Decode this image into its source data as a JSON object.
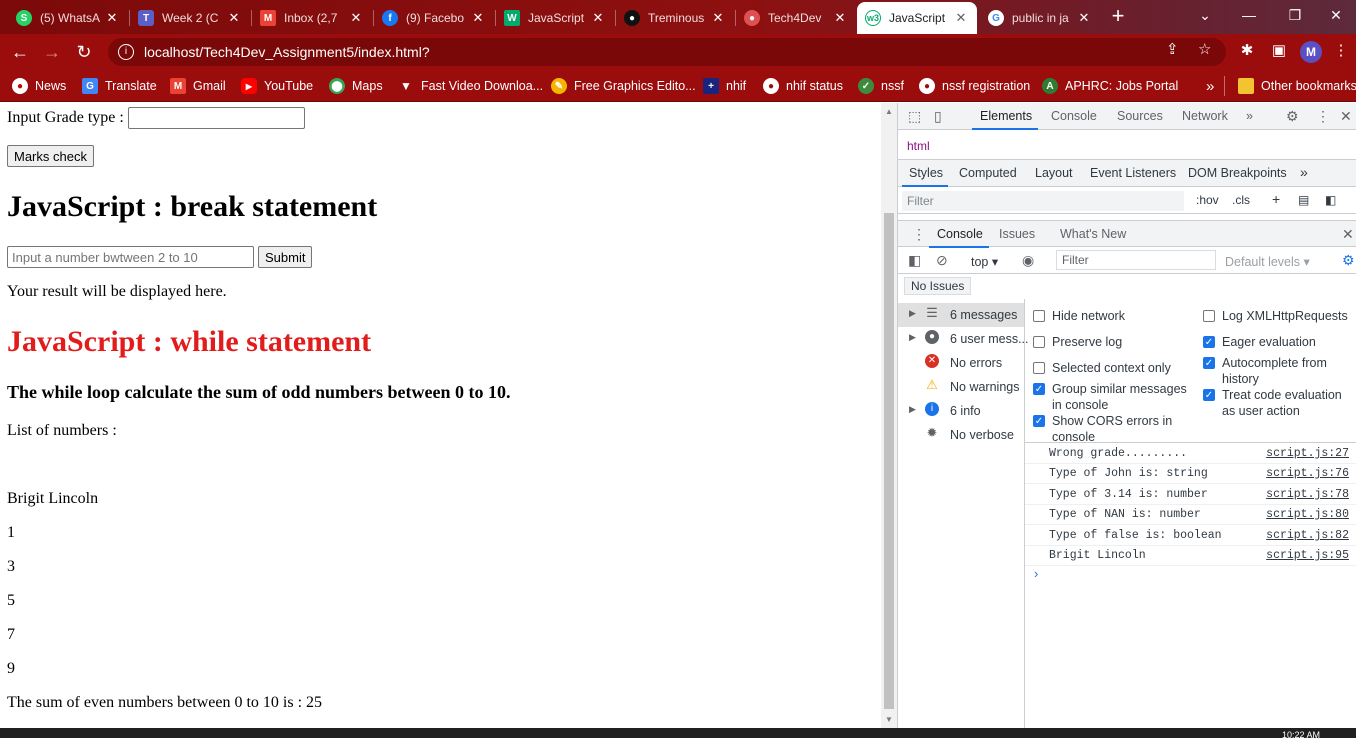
{
  "tabs": [
    {
      "title": "(5) WhatsA",
      "fav": "S",
      "color": "#25d366"
    },
    {
      "title": "Week 2 (C",
      "fav": "T",
      "color": "#5b5fc7"
    },
    {
      "title": "Inbox (2,7",
      "fav": "M",
      "color": "#ea4335"
    },
    {
      "title": "(9) Facebo",
      "fav": "f",
      "color": "#1877f2"
    },
    {
      "title": "JavaScript",
      "fav": "W",
      "color": "#04aa6d"
    },
    {
      "title": "Treminous",
      "fav": "●",
      "color": "#111111"
    },
    {
      "title": "Tech4Dev",
      "fav": "●",
      "color": "#e05050"
    },
    {
      "title": "JavaScript",
      "fav": "w3",
      "color": "#04aa6d"
    },
    {
      "title": "public in ja",
      "fav": "G",
      "color": "#4285f4"
    }
  ],
  "address": {
    "url": "localhost/Tech4Dev_Assignment5/index.html?"
  },
  "bookmarks": {
    "items": [
      "News",
      "Translate",
      "Gmail",
      "YouTube",
      "Maps",
      "Fast Video Downloa...",
      "Free Graphics Edito...",
      "nhif",
      "nhif status",
      "nssf",
      "nssf registration",
      "APHRC: Jobs Portal"
    ],
    "more": "»",
    "other": "Other bookmarks"
  },
  "page": {
    "grade_label": "Input Grade type :",
    "marks_button": "Marks check",
    "break_heading": "JavaScript : break statement",
    "number_placeholder": "Input a number bwtween 2 to 10",
    "submit_button": "Submit",
    "result_text": "Your result will be displayed here.",
    "while_heading": "JavaScript : while statement",
    "while_color": "#e21b1b",
    "while_desc": "The while loop calculate the sum of odd numbers between 0 to 10.",
    "list_label": "List of numbers :",
    "name": "Brigit Lincoln",
    "numbers": [
      "1",
      "3",
      "5",
      "7",
      "9"
    ],
    "sum_text": "The sum of even numbers between 0 to 10 is : 25"
  },
  "devtools": {
    "tabs": [
      "Elements",
      "Console",
      "Sources",
      "Network"
    ],
    "more": "»",
    "crumb": "html",
    "style_tabs": [
      "Styles",
      "Computed",
      "Layout",
      "Event Listeners",
      "DOM Breakpoints"
    ],
    "styles_filter": "Filter",
    "hov": ":hov",
    "cls": ".cls",
    "drawer_tabs": [
      "Console",
      "Issues",
      "What's New"
    ],
    "context": "top",
    "console_filter": "Filter",
    "levels": "Default levels",
    "no_issues": "No Issues",
    "sidebar": [
      {
        "label": "6 messages",
        "icon": "list-icon"
      },
      {
        "label": "6 user mess...",
        "icon": "user-icon"
      },
      {
        "label": "No errors",
        "icon": "error-icon"
      },
      {
        "label": "No warnings",
        "icon": "warning-icon"
      },
      {
        "label": "6 info",
        "icon": "info-icon"
      },
      {
        "label": "No verbose",
        "icon": "bug-icon"
      }
    ],
    "settings": {
      "hide_network": "Hide network",
      "preserve_log": "Preserve log",
      "selected_context": "Selected context only",
      "group_similar": "Group similar messages in console",
      "show_cors": "Show CORS errors in console",
      "log_xhr": "Log XMLHttpRequests",
      "eager_eval": "Eager evaluation",
      "autocomplete": "Autocomplete from history",
      "treat_code": "Treat code evaluation as user action"
    },
    "logs": [
      {
        "msg": "Wrong grade.........",
        "src": "script.js:27"
      },
      {
        "msg": "Type of John is: string",
        "src": "script.js:76"
      },
      {
        "msg": "Type of 3.14 is: number",
        "src": "script.js:78"
      },
      {
        "msg": "Type of NAN is: number",
        "src": "script.js:80"
      },
      {
        "msg": "Type of false is: boolean",
        "src": "script.js:82"
      },
      {
        "msg": "Brigit Lincoln",
        "src": "script.js:95"
      }
    ],
    "prompt": "›"
  },
  "taskbar": {
    "clock": "10:22 AM"
  }
}
